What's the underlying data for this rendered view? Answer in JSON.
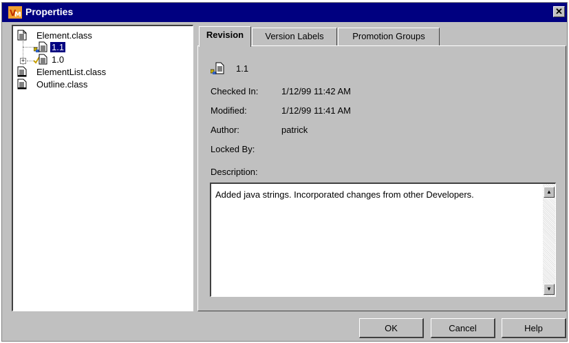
{
  "window": {
    "title": "Properties",
    "close_glyph": "✕"
  },
  "tree": {
    "items": [
      {
        "label": "Element.class"
      },
      {
        "label": "1.1"
      },
      {
        "label": "1.0"
      },
      {
        "label": "ElementList.class"
      },
      {
        "label": "Outline.class"
      }
    ]
  },
  "tabs": [
    {
      "label": "Revision"
    },
    {
      "label": "Version Labels"
    },
    {
      "label": "Promotion Groups"
    }
  ],
  "revision": {
    "number": "1.1",
    "checked_in_label": "Checked In:",
    "checked_in_value": "1/12/99 11:42 AM",
    "modified_label": "Modified:",
    "modified_value": "1/12/99 11:41 AM",
    "author_label": "Author:",
    "author_value": "patrick",
    "locked_by_label": "Locked By:",
    "locked_by_value": "",
    "description_label": "Description:",
    "description_value": "Added java strings.  Incorporated changes from other Developers."
  },
  "buttons": {
    "ok": "OK",
    "cancel": "Cancel",
    "help": "Help"
  },
  "colors": {
    "titlebar": "#000080",
    "dialog": "#c0c0c0",
    "selection": "#000080"
  }
}
